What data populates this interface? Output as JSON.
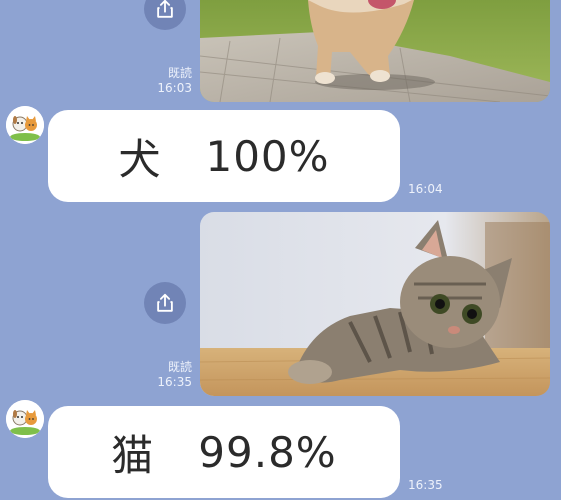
{
  "messages": [
    {
      "type": "outgoing-photo",
      "subject": "dog",
      "read_label": "既読",
      "time": "16:03"
    },
    {
      "type": "incoming-text",
      "animal": "犬",
      "score": "100%",
      "time": "16:04"
    },
    {
      "type": "outgoing-photo",
      "subject": "cat",
      "read_label": "既読",
      "time": "16:35"
    },
    {
      "type": "incoming-text",
      "animal": "猫",
      "score": "99.8%",
      "time": "16:35"
    }
  ],
  "icons": {
    "share": "share-icon",
    "avatar": "dog-and-cat-avatar-icon"
  },
  "colors": {
    "background": "#8ea3d2",
    "bubble": "#ffffff",
    "share_button": "#7184b6",
    "meta_text": "#eef2fb"
  }
}
